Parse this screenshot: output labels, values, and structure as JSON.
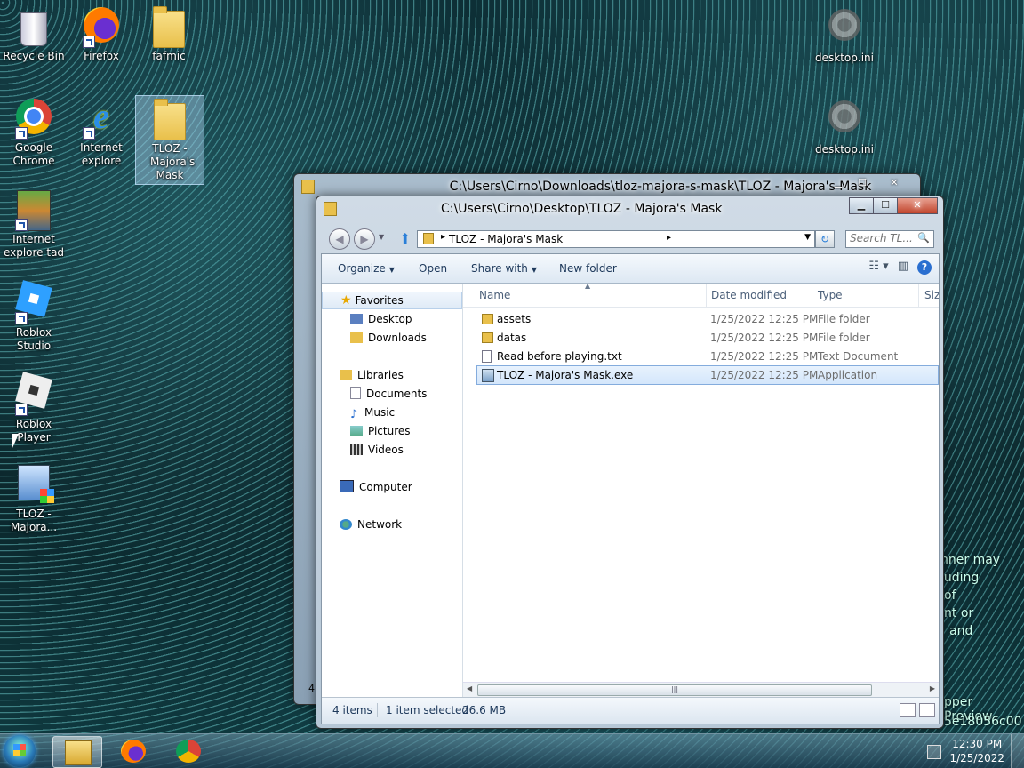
{
  "desktop": {
    "icons": [
      {
        "label": "Recycle Bin"
      },
      {
        "label": "Firefox"
      },
      {
        "label": "fafmic"
      },
      {
        "label": "desktop.ini"
      },
      {
        "label": "Google Chrome"
      },
      {
        "label": "Internet explore"
      },
      {
        "label": "TLOZ - Majora's Mask"
      },
      {
        "label": "desktop.ini"
      },
      {
        "label": "Internet explore tad"
      },
      {
        "label": "Roblox Studio"
      },
      {
        "label": "Roblox Player"
      },
      {
        "label": "TLOZ - Majora..."
      }
    ],
    "overlay_lines": [
      "nner may",
      "luding",
      "of",
      "nt or",
      "and",
      "pper Preview",
      "5e18056c00"
    ]
  },
  "back_window": {
    "title": "C:\\Users\\Cirno\\Downloads\\tloz-majora-s-mask\\TLOZ - Majora's Mask",
    "corner_char": "4"
  },
  "window": {
    "title": "C:\\Users\\Cirno\\Desktop\\TLOZ - Majora's Mask",
    "controls": {
      "minimize": "▁",
      "maximize": "☐",
      "close": "✕"
    },
    "address": {
      "crumb": "TLOZ - Majora's Mask"
    },
    "search": {
      "placeholder": "Search TL..."
    },
    "toolbar": {
      "organize": "Organize",
      "open": "Open",
      "share_with": "Share with",
      "new_folder": "New folder"
    },
    "nav": {
      "favorites": "Favorites",
      "desktop": "Desktop",
      "downloads": "Downloads",
      "libraries": "Libraries",
      "documents": "Documents",
      "music": "Music",
      "pictures": "Pictures",
      "videos": "Videos",
      "computer": "Computer",
      "network": "Network"
    },
    "columns": {
      "name": "Name",
      "date": "Date modified",
      "type": "Type",
      "size": "Size"
    },
    "files": [
      {
        "name": "assets",
        "date": "1/25/2022 12:25 PM",
        "type": "File folder"
      },
      {
        "name": "datas",
        "date": "1/25/2022 12:25 PM",
        "type": "File folder"
      },
      {
        "name": "Read before playing.txt",
        "date": "1/25/2022 12:25 PM",
        "type": "Text Document"
      },
      {
        "name": "TLOZ - Majora's Mask.exe",
        "date": "1/25/2022 12:25 PM",
        "type": "Application"
      }
    ],
    "status": {
      "items": "4 items",
      "selected": "1 item selected",
      "size": "26.6 MB"
    }
  },
  "taskbar": {
    "time": "12:30 PM",
    "date": "1/25/2022"
  }
}
